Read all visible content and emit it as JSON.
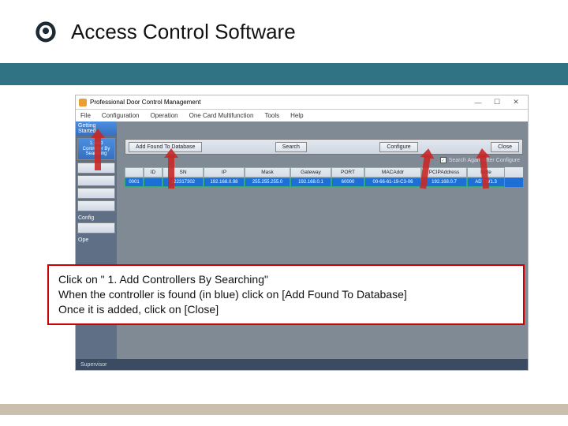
{
  "header": {
    "title": "Access Control Software"
  },
  "window": {
    "title": "Professional Door Control Management",
    "min": "—",
    "max": "☐",
    "close": "✕"
  },
  "menu": {
    "file": "File",
    "configuration": "Configuration",
    "operation": "Operation",
    "onecard": "One Card Multifunction",
    "tools": "Tools",
    "help": "Help"
  },
  "sidebar": {
    "section": "Getting Started",
    "addControllers": "1. Add Controller By Searching",
    "configLabel": "Config",
    "opsLabel": "Ope"
  },
  "toolbar": {
    "addFound": "Add Found To Database",
    "search": "Search",
    "configure": "Configure",
    "close": "Close",
    "checkboxLabel": "Search Again After Configure",
    "checked": "✓"
  },
  "grid": {
    "headers": [
      "",
      "ID",
      "SN",
      "IP",
      "Mask",
      "Gateway",
      "PORT",
      "MACAddr",
      "PCIPAddress",
      "Note"
    ],
    "row": [
      "0001",
      "",
      "122317302",
      "192.168.0.98",
      "255.255.255.0",
      "192.168.0.1",
      "60000",
      "00-66-61-19-C3-06",
      "192.168.0.7",
      "ADT W1.3"
    ]
  },
  "status": {
    "label": "Supervisor"
  },
  "instructions": {
    "line1": "Click on \" 1. Add Controllers By Searching\"",
    "line2": "When  the controller is found (in blue) click on [Add Found To Database]",
    "line3": "Once it is added, click on [Close]"
  }
}
